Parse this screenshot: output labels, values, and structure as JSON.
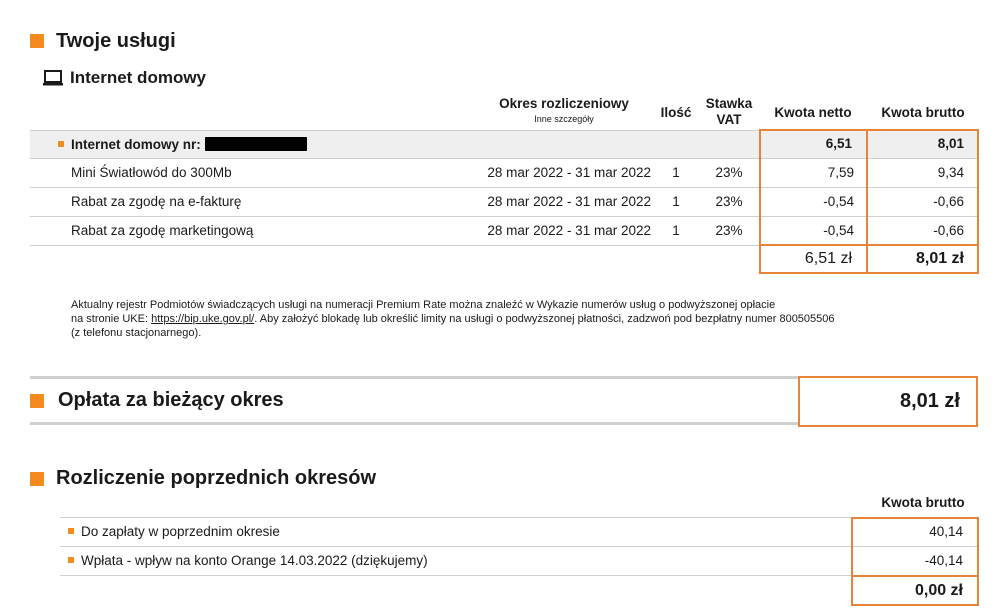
{
  "section_services": {
    "title": "Twoje usługi"
  },
  "internet": {
    "title": "Internet domowy",
    "icon": "laptop-icon"
  },
  "table": {
    "headers": {
      "period": "Okres rozliczeniowy",
      "period_sub": "Inne szczegóły",
      "qty": "Ilość",
      "vat_line1": "Stawka",
      "vat_line2": "VAT",
      "net": "Kwota netto",
      "gross": "Kwota brutto"
    },
    "group": {
      "label": "Internet domowy nr:",
      "net": "6,51",
      "gross": "8,01"
    },
    "rows": [
      {
        "name": "Mini Światłowód do 300Mb",
        "period": "28 mar 2022 - 31 mar 2022",
        "qty": "1",
        "vat": "23%",
        "net": "7,59",
        "gross": "9,34"
      },
      {
        "name": "Rabat za zgodę na e-fakturę",
        "period": "28 mar 2022 - 31 mar 2022",
        "qty": "1",
        "vat": "23%",
        "net": "-0,54",
        "gross": "-0,66"
      },
      {
        "name": "Rabat za zgodę marketingową",
        "period": "28 mar 2022 - 31 mar 2022",
        "qty": "1",
        "vat": "23%",
        "net": "-0,54",
        "gross": "-0,66"
      }
    ],
    "total_net": "6,51 zł",
    "total_gross": "8,01 zł"
  },
  "notice": {
    "line1": "Aktualny rejestr Podmiotów świadczących usługi na numeracji Premium Rate można znaleźć w Wykazie numerów usług o podwyższonej opłacie",
    "line2_pre": "na stronie UKE: ",
    "link": "https://bip.uke.gov.pl/",
    "line2_post": ". Aby założyć blokadę lub określić limity na usługi o podwyższonej płatności, zadzwoń pod bezpłatny numer 800505506",
    "line3": "(z telefonu stacjonarnego)."
  },
  "current_period": {
    "label": "Opłata za bieżący okres",
    "amount": "8,01 zł"
  },
  "previous": {
    "title": "Rozliczenie poprzednich okresów",
    "header_gross": "Kwota brutto",
    "rows": [
      {
        "label": "Do zapłaty w poprzednim okresie",
        "amount": "40,14"
      },
      {
        "label": "Wpłata - wpływ na konto Orange 14.03.2022 (dziękujemy)",
        "amount": "-40,14"
      }
    ],
    "total": "0,00 zł"
  },
  "colors": {
    "accent": "#f28c1e",
    "box_border": "#e8833a",
    "row_bg": "#efefef"
  }
}
